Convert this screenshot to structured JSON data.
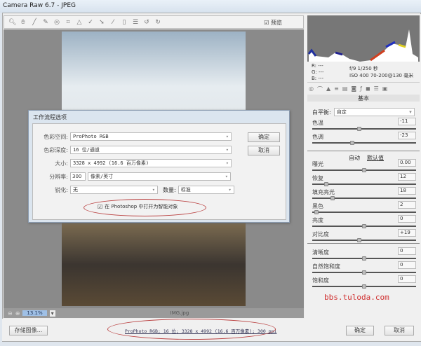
{
  "window": {
    "title": "Camera Raw 6.7 -  JPEG"
  },
  "toolbar": {
    "tools": [
      "zoom-icon",
      "hand-icon",
      "white-balance-icon",
      "color-sampler-icon",
      "target-adjust-icon",
      "crop-icon",
      "straighten-icon",
      "spot-removal-icon",
      "red-eye-icon",
      "adjustment-brush-icon",
      "graduated-filter-icon",
      "preferences-icon",
      "rotate-left-icon",
      "rotate-right-icon"
    ],
    "preview_label": "预览",
    "preview_checked": true
  },
  "status": {
    "zoom": "13.1%",
    "filename": "IMG.jpg"
  },
  "dialog": {
    "title": "工作流程选项",
    "color_space_label": "色彩空间:",
    "color_space": "ProPhoto RGB",
    "depth_label": "色彩深度:",
    "depth": "16 位/通道",
    "size_label": "大小:",
    "size": "3328 x 4992  (16.6 百万像素)",
    "resolution_label": "分辨率:",
    "resolution": "300",
    "resolution_unit": "像素/英寸",
    "sharpen_label": "锐化:",
    "sharpen": "无",
    "amount_label": "数量:",
    "amount": "标准",
    "smart_object_label": "在 Photoshop 中打开为智能对象",
    "smart_object_checked": true,
    "ok": "确定",
    "cancel": "取消"
  },
  "info": {
    "r": "R: ---",
    "g": "G: ---",
    "b": "B: ---",
    "exposure": "f/9  1/250 秒",
    "iso_lens": "ISO 400  70-200@130 毫米"
  },
  "panel": {
    "section": "基本",
    "wb_label": "白平衡:",
    "wb": "自定",
    "auto": "自动",
    "default": "默认值",
    "sliders": [
      {
        "label": "色温",
        "value": "-11",
        "pos": 0.45
      },
      {
        "label": "色调",
        "value": "-23",
        "pos": 0.38
      },
      {
        "label": "曝光",
        "value": "0.00",
        "pos": 0.5
      },
      {
        "label": "恢复",
        "value": "12",
        "pos": 0.12
      },
      {
        "label": "填充亮光",
        "value": "18",
        "pos": 0.18
      },
      {
        "label": "黑色",
        "value": "2",
        "pos": 0.02
      },
      {
        "label": "亮度",
        "value": "0",
        "pos": 0.5
      },
      {
        "label": "对比度",
        "value": "+19",
        "pos": 0.45
      },
      {
        "label": "清晰度",
        "value": "0",
        "pos": 0.5
      },
      {
        "label": "自然饱和度",
        "value": "0",
        "pos": 0.5
      },
      {
        "label": "饱和度",
        "value": "0",
        "pos": 0.5
      }
    ]
  },
  "watermark": "bbs.tuloda.com",
  "footer": {
    "save": "存储图像...",
    "workflow": "ProPhoto RGB; 16 位; 3328 x 4992 (16.6 百万像素); 300 ppi",
    "ok": "确定",
    "cancel": "取消"
  }
}
